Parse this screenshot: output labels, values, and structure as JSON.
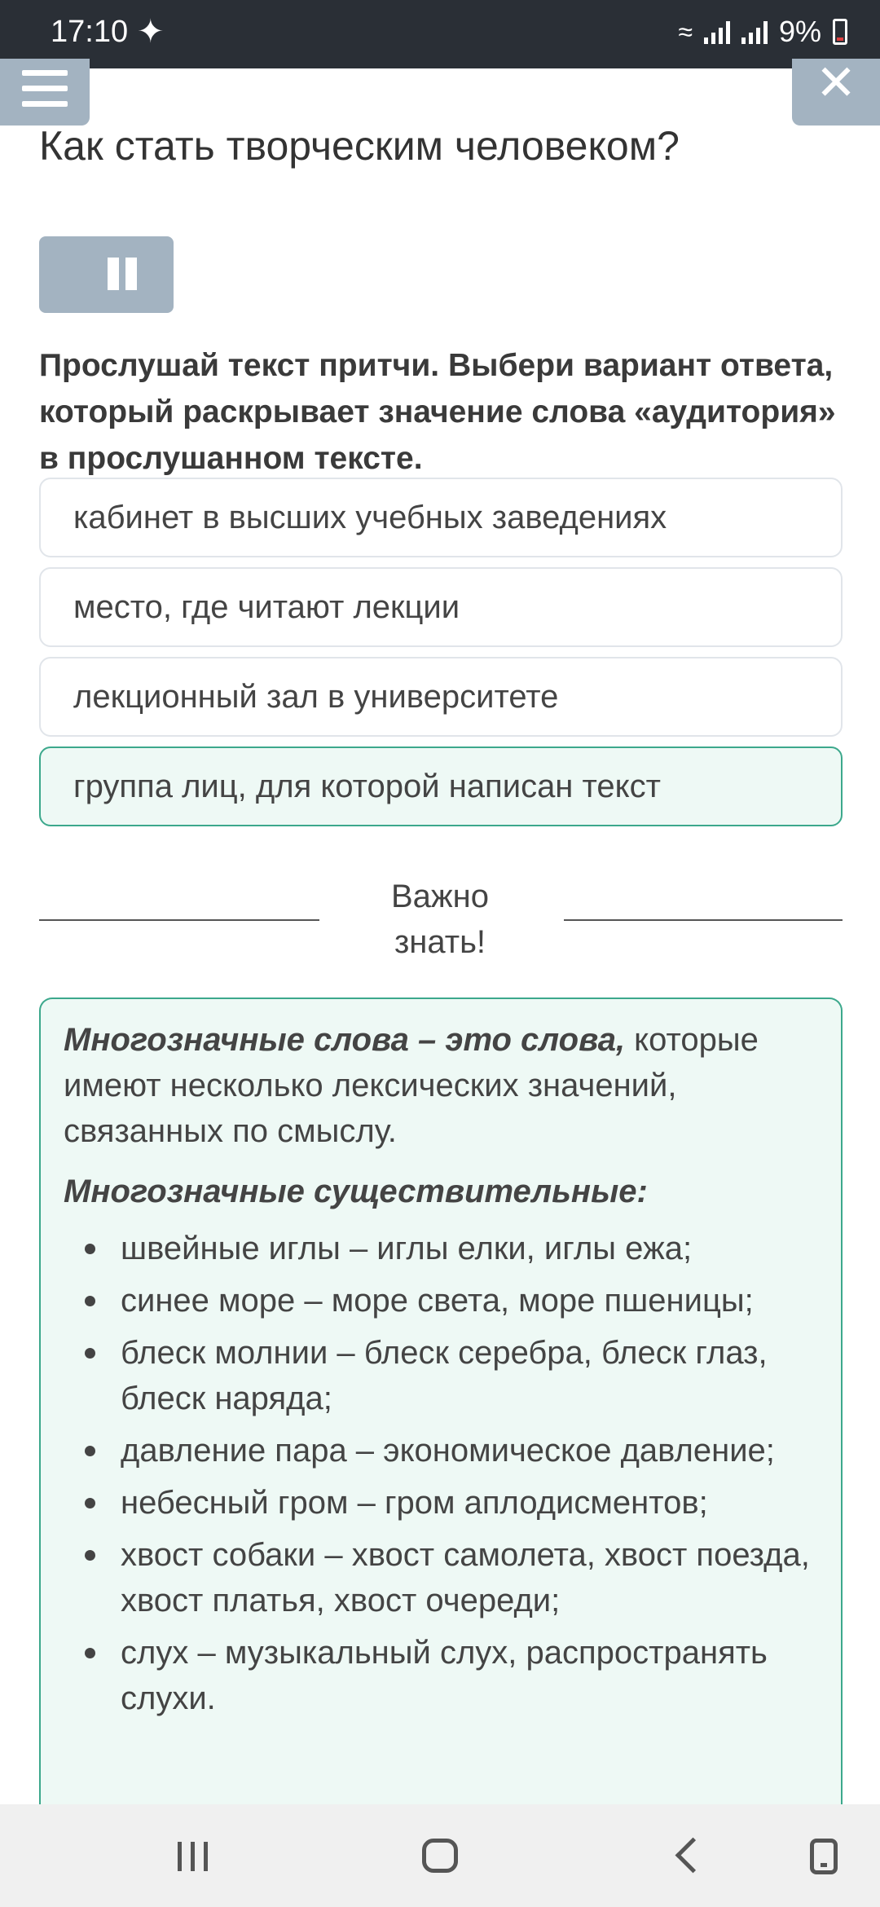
{
  "status_bar": {
    "time": "17:10",
    "left_icon": "notification-icon",
    "battery": "9%",
    "icons": [
      "wifi-icon",
      "signal-icon",
      "signal-icon",
      "battery-charging-icon"
    ]
  },
  "header": {
    "menu_icon": "hamburger-menu-icon",
    "close_icon": "close-icon",
    "title": "Как стать творческим человеком?"
  },
  "audio": {
    "state": "playing",
    "control_icon": "pause-icon"
  },
  "question": {
    "text": "Прослушай текст притчи. Выбери вариант ответа, который раскрывает значение слова «аудитория» в прослушанном тексте."
  },
  "options": [
    {
      "label": "кабинет в высших учебных заведениях",
      "selected": false
    },
    {
      "label": "место, где читают лекции",
      "selected": false
    },
    {
      "label": "лекционный зал в университете",
      "selected": false
    },
    {
      "label": "группа лиц, для которой написан текст",
      "selected": true
    }
  ],
  "important": {
    "line1": "Важно",
    "line2": "знать!"
  },
  "info": {
    "definition_bold": "Многозначные слова – это слова,",
    "definition_rest": " которые имеют несколько лексических значений, связанных по смыслу.",
    "subheading": "Многозначные существительные:",
    "examples": [
      "швейные иглы – иглы елки, иглы ежа;",
      "синее море – море света, море пшеницы;",
      "блеск молнии – блеск серебра, блеск глаз, блеск наряда;",
      "давление пара – экономическое давление;",
      "небесный гром – гром аплодисментов;",
      "хвост собаки – хвост самолета, хвост поезда, хвост платья, хвост очереди;",
      "слух – музыкальный слух, распространять слухи."
    ]
  },
  "nav_bar": {
    "icons": [
      "recent-apps-icon",
      "home-icon",
      "back-icon",
      "screenshot-icon"
    ]
  },
  "colors": {
    "accent_button": "#a3b3c1",
    "correct_border": "#3ca88c",
    "correct_fill": "#eef9f5",
    "status_bar": "#2a2f36"
  }
}
